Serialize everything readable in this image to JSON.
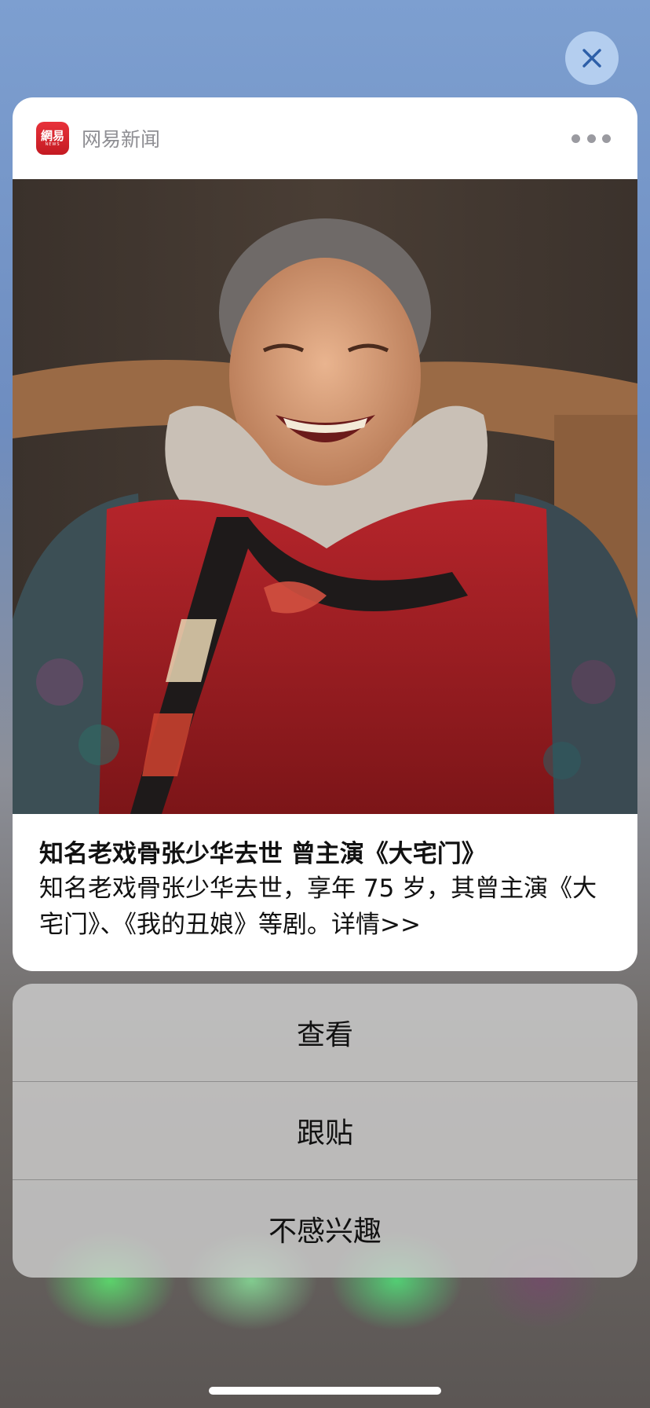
{
  "notification": {
    "app_name": "网易新闻",
    "app_icon_text": "網易",
    "app_icon_subtext": "NEWS",
    "headline": "知名老戏骨张少华去世 曾主演《大宅门》",
    "body": "知名老戏骨张少华去世，享年 75 岁，其曾主演《大宅门》、《我的丑娘》等剧。详情>>"
  },
  "actions": [
    {
      "label": "查看"
    },
    {
      "label": "跟贴"
    },
    {
      "label": "不感兴趣"
    }
  ],
  "icons": {
    "close": "close-icon",
    "more": "more-icon",
    "app": "netease-news-icon"
  },
  "colors": {
    "accent_red": "#d9252e",
    "secondary_text": "#8e8e93",
    "card_bg": "#ffffff"
  }
}
